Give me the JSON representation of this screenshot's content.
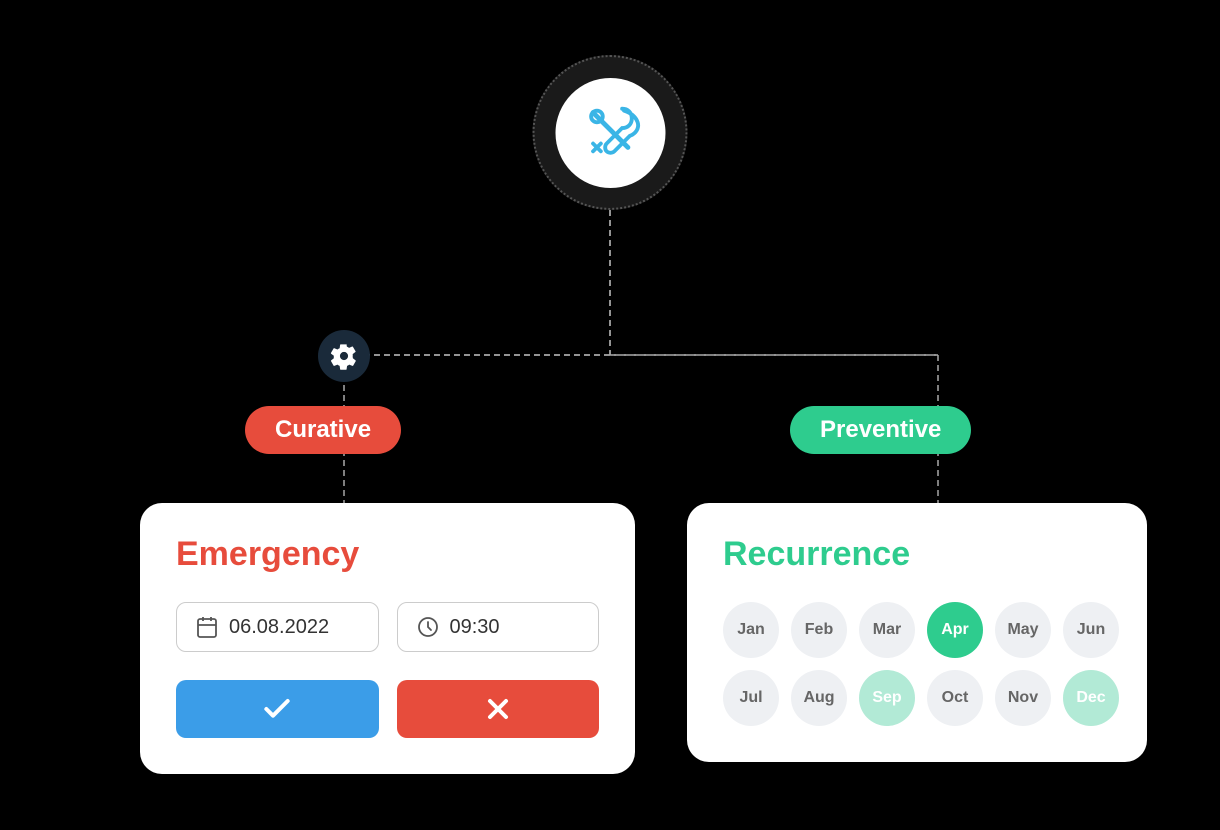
{
  "diagram": {
    "topIcon": {
      "alt": "maintenance tools icon"
    },
    "gearNode": {
      "alt": "gear settings node"
    },
    "curativeBadge": "Curative",
    "preventiveBadge": "Preventive",
    "emergencyCard": {
      "title": "Emergency",
      "dateValue": "06.08.2022",
      "timeValue": "09:30",
      "datePlaceholder": "Date",
      "timePlaceholder": "Time",
      "confirmLabel": "Confirm",
      "cancelLabel": "Cancel"
    },
    "recurrenceCard": {
      "title": "Recurrence",
      "months": [
        {
          "label": "Jan",
          "state": "inactive"
        },
        {
          "label": "Feb",
          "state": "inactive"
        },
        {
          "label": "Mar",
          "state": "inactive"
        },
        {
          "label": "Apr",
          "state": "active-green"
        },
        {
          "label": "May",
          "state": "inactive"
        },
        {
          "label": "Jun",
          "state": "inactive"
        },
        {
          "label": "Jul",
          "state": "inactive"
        },
        {
          "label": "Aug",
          "state": "inactive"
        },
        {
          "label": "Sep",
          "state": "active-light"
        },
        {
          "label": "Oct",
          "state": "inactive"
        },
        {
          "label": "Nov",
          "state": "inactive"
        },
        {
          "label": "Dec",
          "state": "active-light"
        }
      ]
    }
  }
}
